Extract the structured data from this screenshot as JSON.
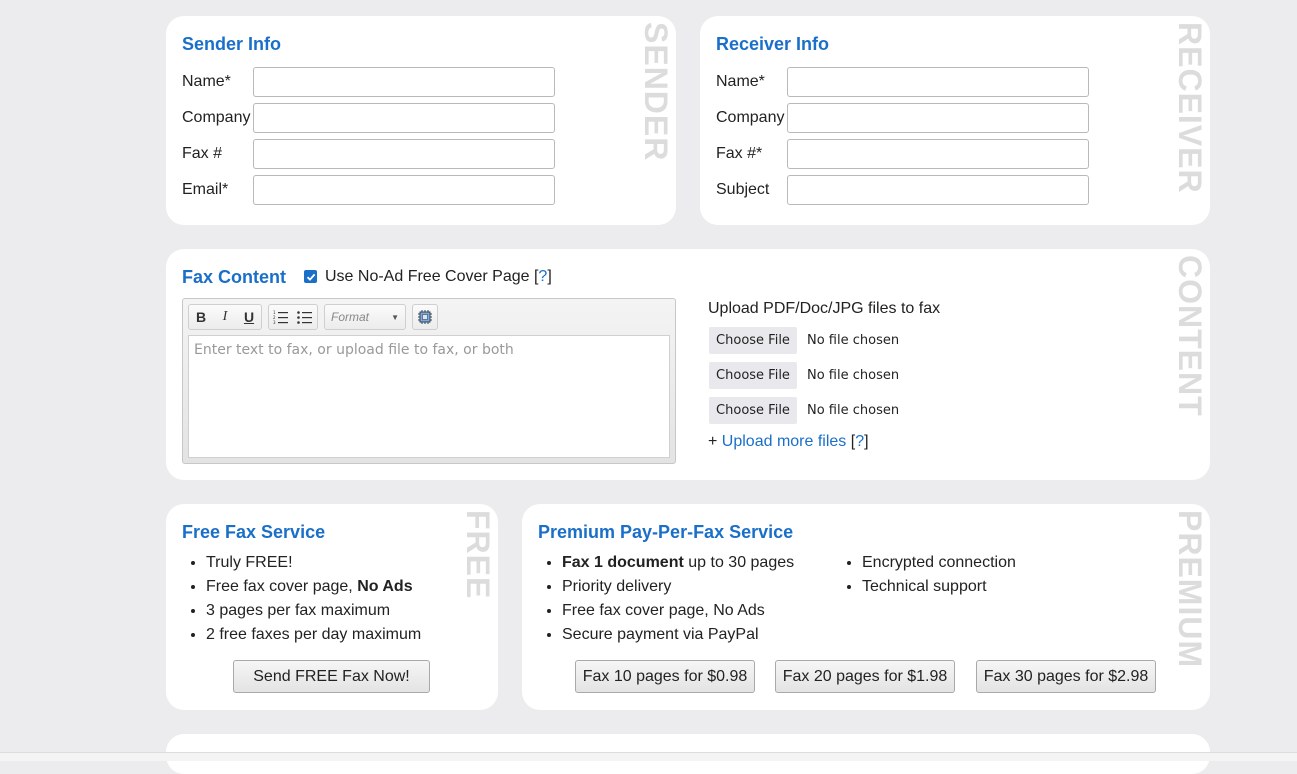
{
  "sender": {
    "title": "Sender Info",
    "watermark": "SENDER",
    "fields": [
      {
        "label": "Name*",
        "value": ""
      },
      {
        "label": "Company",
        "value": ""
      },
      {
        "label": "Fax #",
        "value": ""
      },
      {
        "label": "Email*",
        "value": ""
      }
    ]
  },
  "receiver": {
    "title": "Receiver Info",
    "watermark": "RECEIVER",
    "fields": [
      {
        "label": "Name*",
        "value": ""
      },
      {
        "label": "Company",
        "value": ""
      },
      {
        "label": "Fax #*",
        "value": ""
      },
      {
        "label": "Subject",
        "value": ""
      }
    ]
  },
  "content": {
    "title": "Fax Content",
    "watermark": "CONTENT",
    "cover_page_label": "Use No-Ad Free Cover Page [",
    "cover_page_help": "?",
    "cover_page_close": "]",
    "cover_page_checked": true,
    "toolbar": {
      "bold": "B",
      "italic": "I",
      "underline": "U",
      "format_placeholder": "Format"
    },
    "editor_placeholder": "Enter text to fax, or upload file to fax, or both",
    "upload_label": "Upload PDF/Doc/JPG files to fax",
    "files": [
      {
        "button": "Choose File",
        "status": "No file chosen"
      },
      {
        "button": "Choose File",
        "status": "No file chosen"
      },
      {
        "button": "Choose File",
        "status": "No file chosen"
      }
    ],
    "upload_more_prefix": "+ ",
    "upload_more_link": "Upload more files",
    "upload_more_help_open": " [",
    "upload_more_help": "?",
    "upload_more_help_close": "]"
  },
  "free": {
    "title": "Free Fax Service",
    "watermark": "FREE",
    "items": [
      {
        "text": "Truly FREE!",
        "bold": ""
      },
      {
        "text": "Free fax cover page, ",
        "bold": "No Ads"
      },
      {
        "text": "3 pages per fax maximum",
        "bold": ""
      },
      {
        "text": "2 free faxes per day maximum",
        "bold": ""
      }
    ],
    "button": "Send FREE Fax Now!"
  },
  "premium": {
    "title": "Premium Pay-Per-Fax Service",
    "watermark": "PREMIUM",
    "items_left": [
      {
        "bold": "Fax 1 document",
        "text": " up to 30 pages"
      },
      {
        "bold": "",
        "text": "Priority delivery"
      },
      {
        "bold": "",
        "text": "Free fax cover page, No Ads"
      },
      {
        "bold": "",
        "text": "Secure payment via PayPal"
      }
    ],
    "items_right": [
      {
        "bold": "",
        "text": "Encrypted connection"
      },
      {
        "bold": "",
        "text": "Technical support"
      }
    ],
    "buttons": [
      "Fax 10 pages for $0.98",
      "Fax 20 pages for $1.98",
      "Fax 30 pages for $2.98"
    ]
  },
  "colors": {
    "accent": "#1a6fc9",
    "background": "#ececef",
    "watermark": "#dcdcdc"
  }
}
